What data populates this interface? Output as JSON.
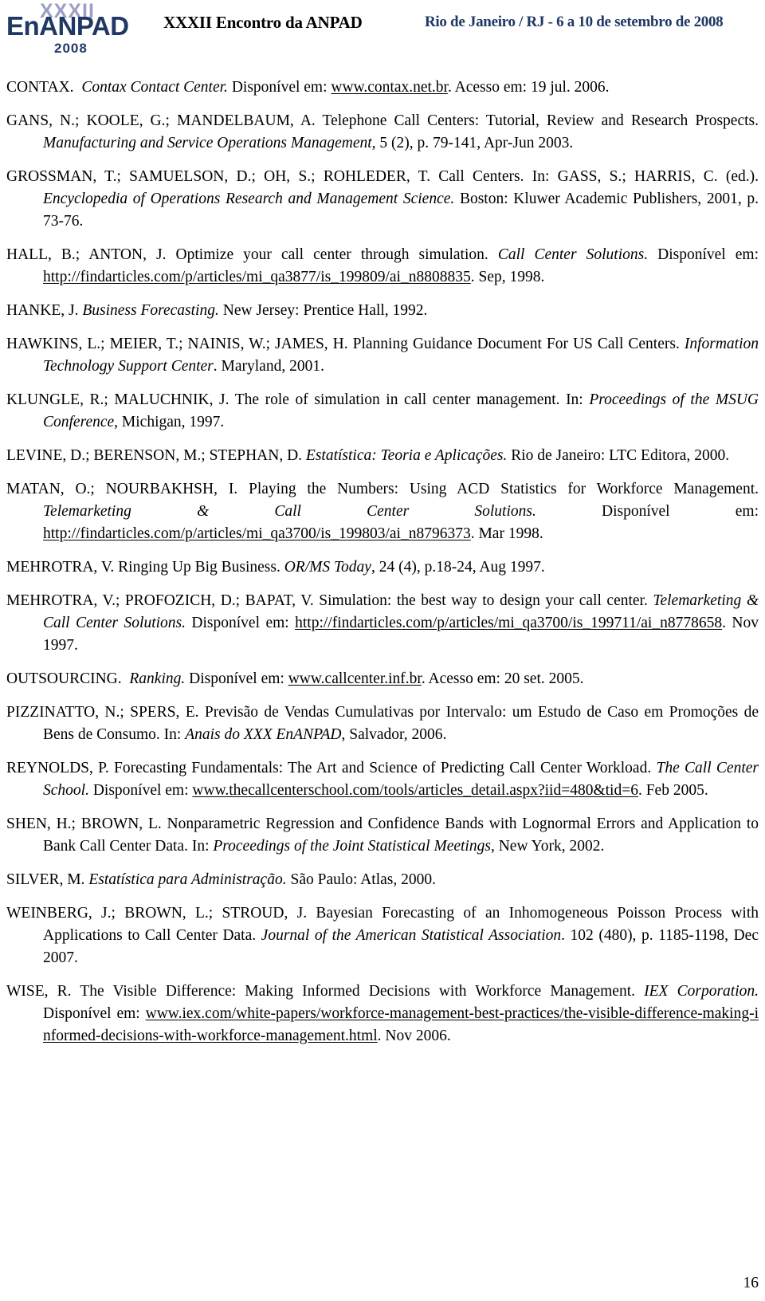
{
  "header": {
    "logo": {
      "roman_numeral": "XXXII",
      "name": "EnANPAD",
      "year": "2008"
    },
    "title": "XXXII Encontro da ANPAD",
    "date_location": "Rio de Janeiro / RJ - 6 a 10 de setembro de 2008"
  },
  "references": [
    {
      "id": "contax",
      "author": "CONTAX.",
      "title_italic": "Contax Contact Center.",
      "text_1": " Disponível em: ",
      "link": "www.contax.net.br",
      "text_2": ". Acesso em: 19 jul. 2006."
    },
    {
      "id": "gans",
      "author": "GANS, N.; KOOLE, G.; MANDELBAUM, A.",
      "text_1": " Telephone Call Centers: Tutorial, Review and Research Prospects. ",
      "title_italic": "Manufacturing and Service Operations Management",
      "text_2": ", 5 (2), p. 79-141, Apr-Jun 2003."
    },
    {
      "id": "grossman",
      "author": "GROSSMAN, T.; SAMUELSON, D.; OH, S.; ROHLEDER, T.",
      "text_1": " Call Centers. In: GASS, S.; HARRIS, C. (ed.). ",
      "title_italic": "Encyclopedia of Operations Research and Management Science.",
      "text_2": " Boston: Kluwer Academic Publishers, 2001, p. 73-76."
    },
    {
      "id": "hall",
      "author": "HALL, B.; ANTON, J.",
      "text_1": " Optimize your call center through simulation. ",
      "title_italic": "Call Center Solutions.",
      "text_2": " Disponível em: ",
      "link": "http://findarticles.com/p/articles/mi_qa3877/is_199809/ai_n8808835",
      "text_3": ". Sep, 1998."
    },
    {
      "id": "hanke",
      "author": "HANKE, J.",
      "text_1": " ",
      "title_italic": "Business Forecasting.",
      "text_2": " New Jersey: Prentice Hall, 1992."
    },
    {
      "id": "hawkins",
      "author": "HAWKINS, L.; MEIER, T.; NAINIS, W.; JAMES, H.",
      "text_1": " Planning Guidance Document For US Call Centers. ",
      "title_italic": "Information Technology Support Center",
      "text_2": ". Maryland, 2001."
    },
    {
      "id": "klungle",
      "author": "KLUNGLE, R.; MALUCHNIK, J.",
      "text_1": " The role of simulation in call center management. In: ",
      "title_italic": "Proceedings of the MSUG Conference",
      "text_2": ", Michigan, 1997."
    },
    {
      "id": "levine",
      "author": "LEVINE, D.; BERENSON, M.; STEPHAN, D.",
      "text_1": " ",
      "title_italic": "Estatística: Teoria e Aplicações.",
      "text_2": " Rio de Janeiro: LTC Editora, 2000."
    },
    {
      "id": "matan",
      "author": "MATAN, O.; NOURBAKHSH, I.",
      "text_1": " Playing the Numbers: Using ACD Statistics for Workforce Management. ",
      "title_italic": "Telemarketing & Call Center Solutions.",
      "text_2": " Disponível em: ",
      "link": "http://findarticles.com/p/articles/mi_qa3700/is_199803/ai_n8796373",
      "text_3": ". Mar 1998."
    },
    {
      "id": "mehrotra1",
      "author": "MEHROTRA, V.",
      "text_1": " Ringing Up Big Business. ",
      "title_italic": "OR/MS Today",
      "text_2": ", 24 (4), p.18-24, Aug 1997."
    },
    {
      "id": "mehrotra2",
      "author": "MEHROTRA, V.; PROFOZICH, D.; BAPAT, V.",
      "text_1": " Simulation: the best way to design your call center. ",
      "title_italic": "Telemarketing & Call Center Solutions.",
      "text_2": " Disponível em: ",
      "link": "http://findarticles.com/p/articles/mi_qa3700/is_199711/ai_n8778658",
      "text_3": ". Nov 1997."
    },
    {
      "id": "outsourcing",
      "author": "OUTSOURCING.",
      "title_italic": "Ranking.",
      "text_1": " Disponível em: ",
      "link": "www.callcenter.inf.br",
      "text_2": ". Acesso em: 20 set. 2005."
    },
    {
      "id": "pizzinatto",
      "author": "PIZZINATTO, N.; SPERS, E.",
      "text_1": " Previsão de Vendas Cumulativas por Intervalo: um Estudo de Caso em Promoções de Bens de Consumo. In: ",
      "title_italic": "Anais do XXX EnANPAD",
      "text_2": ", Salvador, 2006."
    },
    {
      "id": "reynolds",
      "author": "REYNOLDS, P.",
      "text_1": " Forecasting Fundamentals: The Art and Science of Predicting Call Center Workload. ",
      "title_italic": "The Call Center School.",
      "text_2": " Disponível em: ",
      "link": "www.thecallcenterschool.com/tools/articles_detail.aspx?iid=480&tid=6",
      "text_3": ". Feb 2005."
    },
    {
      "id": "shen",
      "author": "SHEN, H.; BROWN, L.",
      "text_1": " Nonparametric Regression and Confidence Bands with Lognormal Errors and Application to Bank Call Center Data. In: ",
      "title_italic": "Proceedings of the Joint Statistical Meetings",
      "text_2": ", New York, 2002."
    },
    {
      "id": "silver",
      "author": "SILVER, M.",
      "text_1": " ",
      "title_italic": "Estatística para Administração.",
      "text_2": " São Paulo: Atlas, 2000."
    },
    {
      "id": "weinberg",
      "author": "WEINBERG, J.; BROWN, L.; STROUD, J.",
      "text_1": " Bayesian Forecasting of an Inhomogeneous Poisson Process with Applications to Call Center Data. ",
      "title_italic": "Journal of the American Statistical Association",
      "text_2": ". 102 (480), p. 1185-1198, Dec 2007."
    },
    {
      "id": "wise",
      "author": "WISE, R.",
      "text_1": " The Visible Difference: Making Informed Decisions with Workforce Management. ",
      "title_italic": "IEX Corporation.",
      "text_2": " Disponível em: ",
      "link": "www.iex.com/white-papers/workforce-management-best-practices/the-visible-difference-making-informed-decisions-with-workforce-management.html",
      "text_3": ". Nov 2006."
    }
  ],
  "footer": {
    "page_number": "16"
  }
}
